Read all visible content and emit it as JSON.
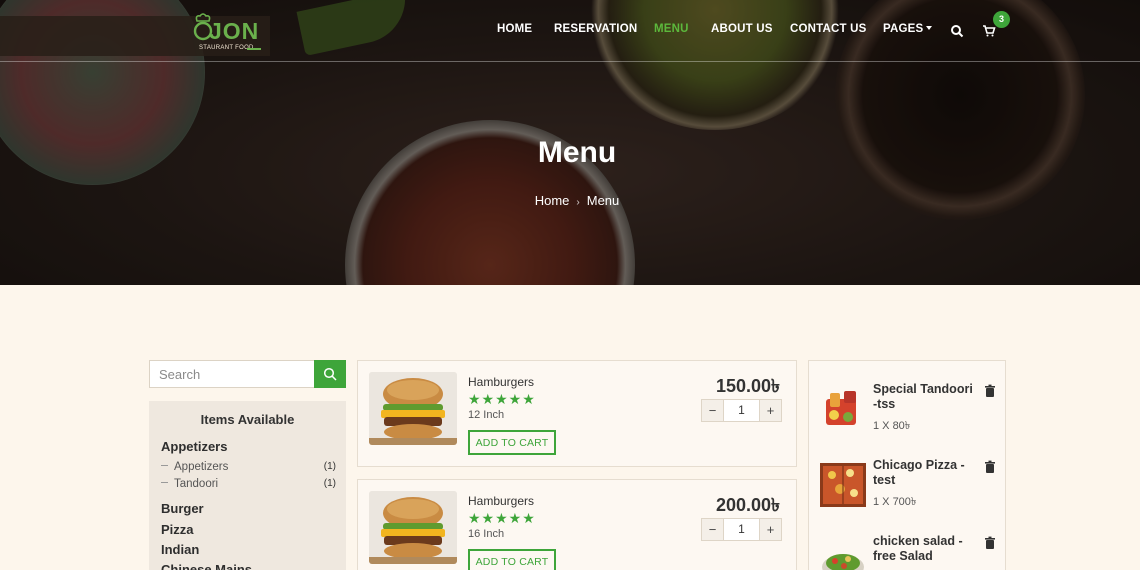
{
  "brand": {
    "logo_text": "JON",
    "tagline": "STAURANT FOOD"
  },
  "nav": {
    "items": [
      "HOME",
      "RESERVATION",
      "MENU",
      "ABOUT US",
      "CONTACT US",
      "PAGES"
    ],
    "active": "MENU",
    "cart_count": "3"
  },
  "hero": {
    "title": "Menu",
    "breadcrumb": [
      "Home",
      "Menu"
    ],
    "separator": "›"
  },
  "sidebar": {
    "search_placeholder": "Search",
    "panel_title": "Items Available",
    "groups": [
      {
        "label": "Appetizers",
        "subitems": [
          {
            "label": "Appetizers",
            "count": "(1)"
          },
          {
            "label": "Tandoori",
            "count": "(1)"
          }
        ]
      },
      {
        "label": "Burger"
      },
      {
        "label": "Pizza"
      },
      {
        "label": "Indian"
      },
      {
        "label": "Chinese Mains"
      }
    ]
  },
  "products": [
    {
      "name": "Hamburgers",
      "rating": 5,
      "stars": "★★★★★",
      "size": "12 Inch",
      "price": "150.00৳",
      "qty": "1",
      "button": "ADD TO CART"
    },
    {
      "name": "Hamburgers",
      "rating": 5,
      "stars": "★★★★★",
      "size": "16 Inch",
      "price": "200.00৳",
      "qty": "1",
      "button": "ADD TO CART"
    }
  ],
  "cart": {
    "items": [
      {
        "name": "Special Tandoori -tss",
        "qty_line": "1 X 80৳"
      },
      {
        "name": "Chicago Pizza - test",
        "qty_line": "1 X 700৳"
      },
      {
        "name": "chicken salad - free Salad",
        "qty_line": ""
      }
    ]
  },
  "colors": {
    "accent": "#3ea53a",
    "page_bg": "#fdf6ec",
    "panel_bg": "#efe8df"
  }
}
